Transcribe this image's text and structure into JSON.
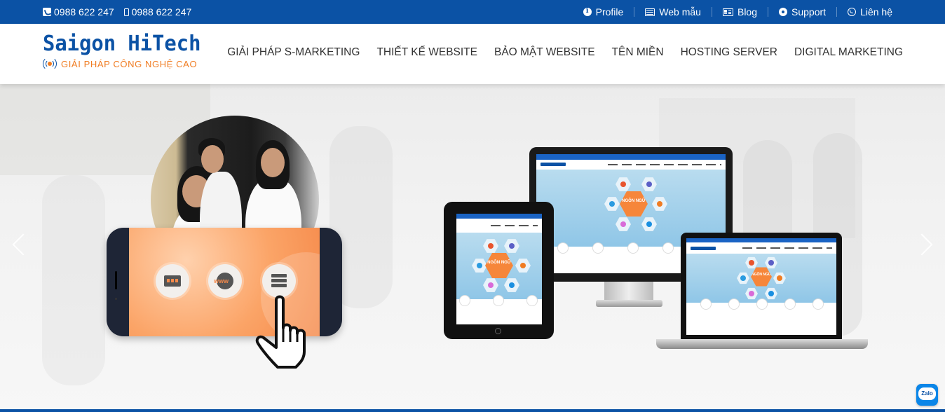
{
  "topbar": {
    "phones": [
      {
        "icon": "phone-square-icon",
        "number": "0988 622 247"
      },
      {
        "icon": "mobile-icon",
        "number": "0988 622 247"
      }
    ],
    "links": [
      {
        "icon": "info-icon",
        "label": "Profile"
      },
      {
        "icon": "list-icon",
        "label": "Web mẫu"
      },
      {
        "icon": "newspaper-icon",
        "label": "Blog"
      },
      {
        "icon": "gear-icon",
        "label": "Support"
      },
      {
        "icon": "whatsapp-icon",
        "label": "Liên hệ"
      }
    ]
  },
  "header": {
    "logo": {
      "title": "Saigon HiTech",
      "tagline": "GIẢI PHÁP CÔNG NGHỆ CAO"
    },
    "nav": [
      {
        "label": "GIẢI PHÁP S-MARKETING"
      },
      {
        "label": "THIẾT KẾ WEBSITE"
      },
      {
        "label": "BẢO MẬT WEBSITE"
      },
      {
        "label": "TÊN MIỀN"
      },
      {
        "label": "HOSTING SERVER"
      },
      {
        "label": "DIGITAL MARKETING"
      }
    ]
  },
  "hero": {
    "phone_app_icons": [
      "monitor-icon",
      "globe-www-icon",
      "server-icon"
    ],
    "device_center_label": "NGÔN NGỮ"
  },
  "colors": {
    "brand_blue": "#0b52a5",
    "brand_orange": "#f07c22",
    "text_dark": "#333333"
  },
  "zalo": {
    "label": "Zalo"
  }
}
